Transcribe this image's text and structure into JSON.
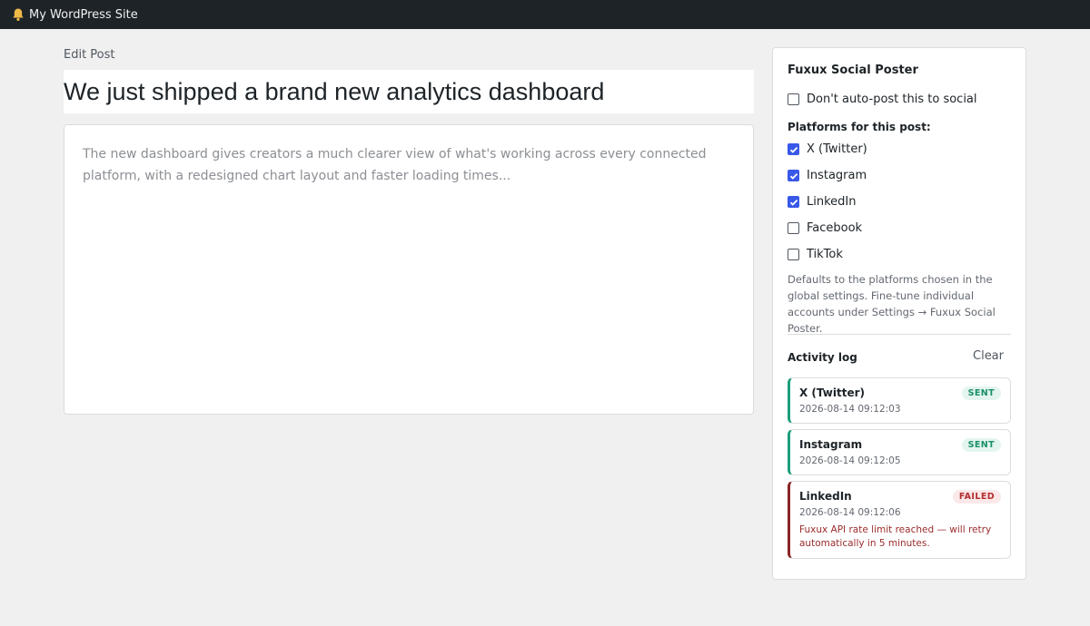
{
  "adminbar": {
    "site_name": "My WordPress Site",
    "icon": "bell-icon"
  },
  "editor": {
    "screen_label": "Edit Post",
    "title": "We just shipped a brand new analytics dashboard",
    "body": "The new dashboard gives creators a much clearer view of what's working across every connected platform, with a redesigned chart layout and faster loading times..."
  },
  "sidebar": {
    "title": "Fuxux Social Poster",
    "dont_autopost": {
      "label": "Don't auto-post this to social",
      "checked": false
    },
    "platforms_heading": "Platforms for this post:",
    "platforms": [
      {
        "label": "X (Twitter)",
        "checked": true
      },
      {
        "label": "Instagram",
        "checked": true
      },
      {
        "label": "LinkedIn",
        "checked": true
      },
      {
        "label": "Facebook",
        "checked": false
      },
      {
        "label": "TikTok",
        "checked": false
      }
    ],
    "help_text": "Defaults to the platforms chosen in the global settings. Fine-tune individual accounts under Settings → Fuxux Social Poster.",
    "activity": {
      "title": "Activity log",
      "clear_label": "Clear",
      "entries": [
        {
          "platform": "X (Twitter)",
          "status": "SENT",
          "time": "2026-08-14 09:12:03",
          "error": ""
        },
        {
          "platform": "Instagram",
          "status": "SENT",
          "time": "2026-08-14 09:12:05",
          "error": ""
        },
        {
          "platform": "LinkedIn",
          "status": "FAILED",
          "time": "2026-08-14 09:12:06",
          "error": "Fuxux API rate limit reached — will retry automatically in 5 minutes."
        }
      ]
    }
  },
  "colors": {
    "adminbar": "#1d2327",
    "accent": "#3858e9",
    "sent": "#1a9d7a",
    "failed": "#8a2424"
  }
}
